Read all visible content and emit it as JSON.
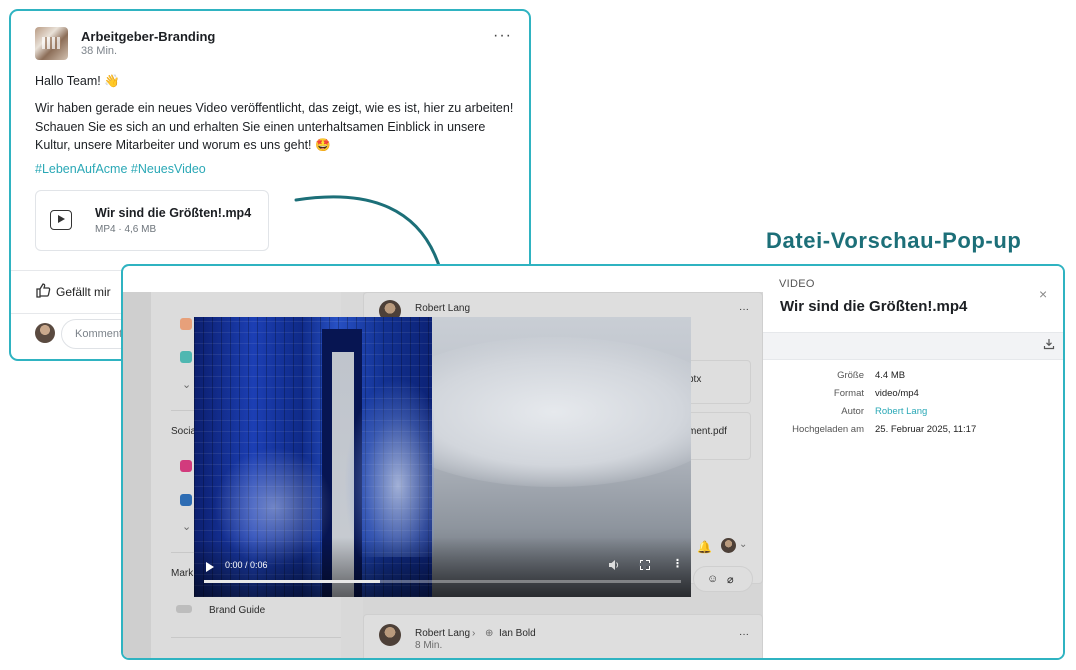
{
  "post": {
    "author": "Arbeitgeber-Branding",
    "time": "38 Min.",
    "more": "···",
    "greeting": "Hallo Team! 👋",
    "body": "Wir haben gerade ein neues Video veröffentlicht, das zeigt, wie es ist, hier zu arbeiten! Schauen Sie es sich an und erhalten Sie einen unterhaltsamen Einblick in unsere Kultur, unsere Mitarbeiter und worum es uns geht! 🤩",
    "hashtags": "#LebenAufAcme #NeuesVideo",
    "attachment": {
      "name": "Wir sind die Größten!.mp4",
      "meta": "MP4  ·  4,6 MB"
    },
    "like_label": "Gefällt mir",
    "comment_placeholder": "Komment"
  },
  "annotation": "Datei-Vorschau-Pop-up",
  "background_app": {
    "sidebar": {
      "section_social": "Socia",
      "section_marketing": "Mark",
      "brand_guide": "Brand Guide"
    },
    "feed": {
      "post1_author": "Robert Lang",
      "file1_suffix": "ptx",
      "file2_suffix": "ment.pdf",
      "post2_author": "Robert Lang",
      "post2_target": "Ian Bold",
      "post2_time": "8 Min.",
      "more": "···"
    }
  },
  "video": {
    "time": "0:00 / 0:06",
    "progress_fraction": 0.37
  },
  "details": {
    "type_label": "VIDEO",
    "title": "Wir sind die Größten!.mp4",
    "close": "×",
    "meta": [
      {
        "key": "Größe",
        "value": "4.4 MB"
      },
      {
        "key": "Format",
        "value": "video/mp4"
      },
      {
        "key": "Autor",
        "value": "Robert Lang"
      },
      {
        "key": "Hochgeladen am",
        "value": "25. Februar 2025, 11:17"
      }
    ]
  },
  "colors": {
    "accent": "#2fb3c1",
    "annotation": "#1c6f78",
    "link": "#2aa8b6"
  }
}
